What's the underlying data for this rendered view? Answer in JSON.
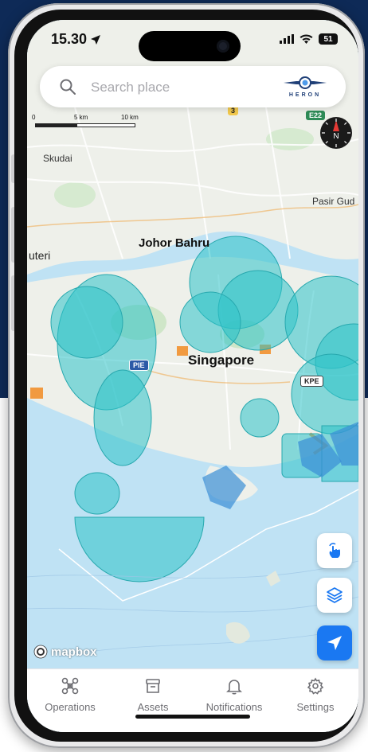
{
  "status_bar": {
    "time": "15.30",
    "battery": "51"
  },
  "search": {
    "placeholder": "Search place",
    "logo_text": "HERON"
  },
  "scale": {
    "labels": [
      "0",
      "5 km",
      "10 km"
    ]
  },
  "compass": {
    "label": "N"
  },
  "map": {
    "labels": {
      "skudai": "Skudai",
      "pasir_gudang": "Pasir Gud",
      "johor_bahru": "Johor Bahru",
      "uteri": "uteri",
      "singapore": "Singapore"
    },
    "road_badges": {
      "pie": "PIE",
      "kpe": "KPE",
      "route3": "3",
      "e22": "E22"
    },
    "attribution": "mapbox"
  },
  "icons": {
    "search": "search-icon",
    "compass": "compass-icon",
    "gesture": "hand-tap-icon",
    "layers": "layers-icon",
    "locate": "navigation-arrow-icon"
  },
  "colors": {
    "accent": "#1a78f2",
    "zone_fill": "#2ec3c9",
    "brand_navy": "#0e2a57",
    "water": "#bfe2f4",
    "land": "#eef0ea"
  },
  "tabs": [
    {
      "label": "Operations",
      "icon": "drone-icon"
    },
    {
      "label": "Assets",
      "icon": "archive-box-icon"
    },
    {
      "label": "Notifications",
      "icon": "bell-icon"
    },
    {
      "label": "Settings",
      "icon": "gear-icon"
    }
  ]
}
